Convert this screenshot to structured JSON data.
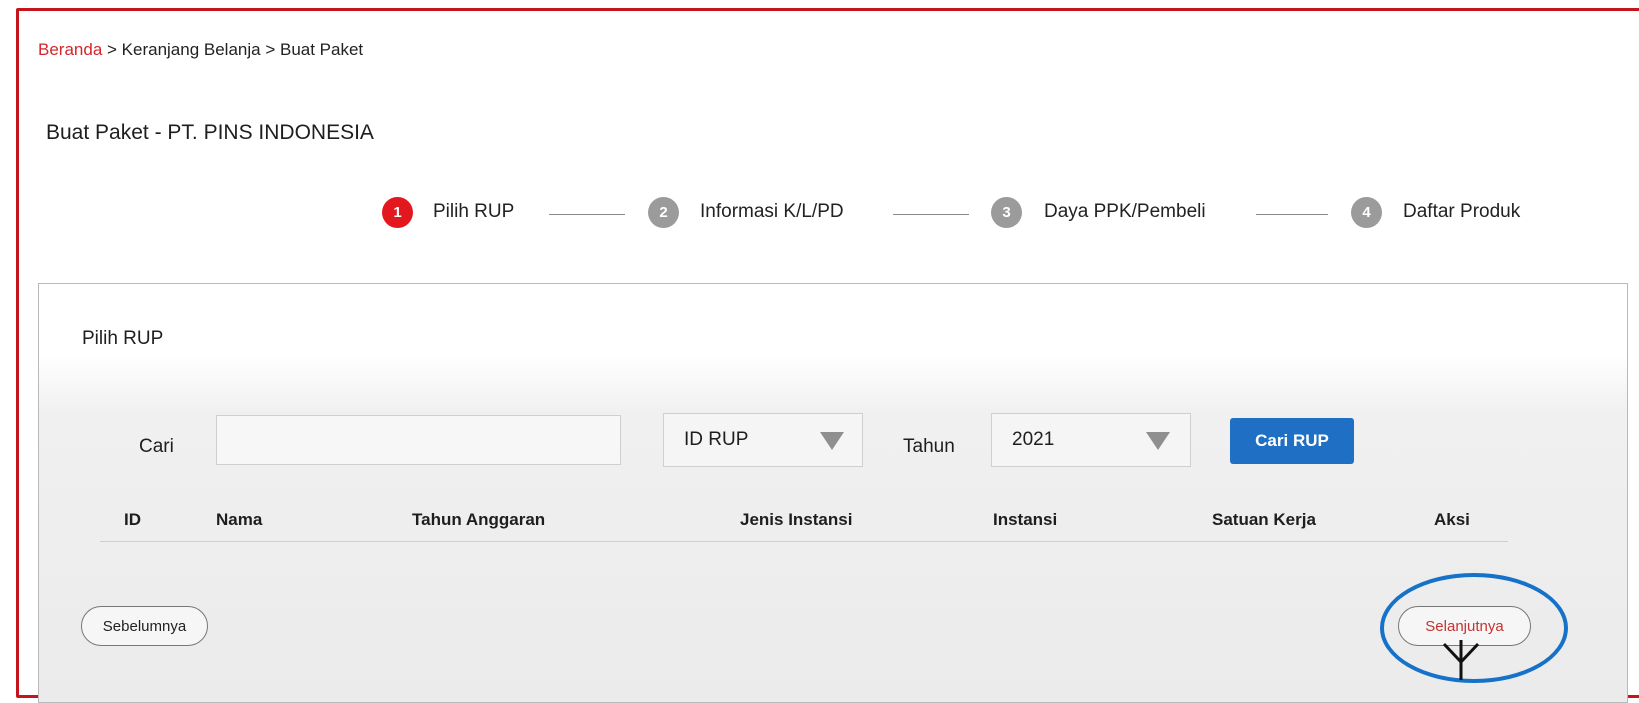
{
  "breadcrumb": {
    "home": "Beranda",
    "separator1": " > ",
    "cart": "Keranjang Belanja",
    "separator2": " > ",
    "current": "Buat Paket"
  },
  "page": {
    "title": "Buat Paket - PT. PINS INDONESIA"
  },
  "stepper": {
    "steps": [
      {
        "number": "1",
        "label": "Pilih RUP",
        "state": "active"
      },
      {
        "number": "2",
        "label": "Informasi K/L/PD",
        "state": "inactive"
      },
      {
        "number": "3",
        "label": "Daya PPK/Pembeli",
        "state": "inactive"
      },
      {
        "number": "4",
        "label": "Daftar Produk",
        "state": "inactive"
      }
    ]
  },
  "panel": {
    "title": "Pilih RUP",
    "search": {
      "label": "Cari",
      "value": "",
      "field_select": "ID RUP",
      "year_label": "Tahun",
      "year_select": "2021",
      "button": "Cari RUP"
    },
    "table": {
      "columns": [
        "ID",
        "Nama",
        "Tahun Anggaran",
        "Jenis Instansi",
        "Instansi",
        "Satuan Kerja",
        "Aksi"
      ],
      "rows": []
    },
    "pagination": {
      "prev": "Sebelumnya",
      "next": "Selanjutnya"
    }
  },
  "colors": {
    "accent_red": "#e3181e",
    "primary_blue": "#1f6fc4",
    "frame_red": "#c4141c",
    "highlight_blue": "#1671c9",
    "step_inactive": "#9b9b9b"
  },
  "icons": {
    "select_arrow": "triangle-down-icon",
    "cursor": "click-cursor-icon"
  }
}
